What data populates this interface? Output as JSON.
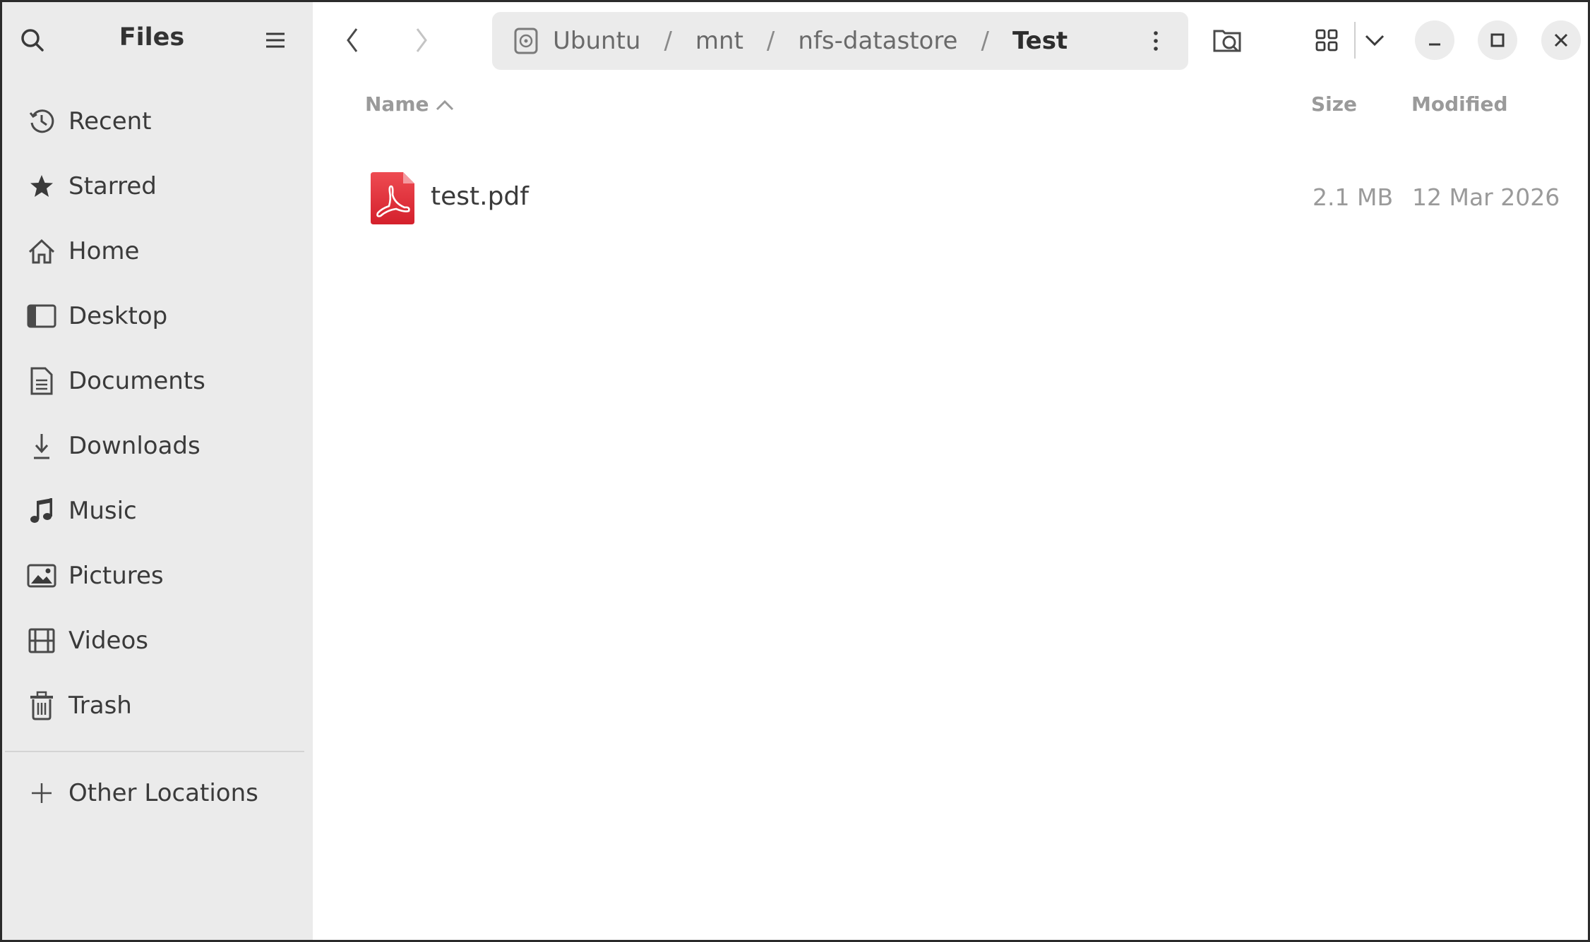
{
  "sidebar": {
    "title": "Files",
    "items": [
      {
        "label": "Recent",
        "icon": "clock-icon"
      },
      {
        "label": "Starred",
        "icon": "star-icon"
      },
      {
        "label": "Home",
        "icon": "home-icon"
      },
      {
        "label": "Desktop",
        "icon": "desktop-icon"
      },
      {
        "label": "Documents",
        "icon": "document-icon"
      },
      {
        "label": "Downloads",
        "icon": "download-icon"
      },
      {
        "label": "Music",
        "icon": "music-note-icon"
      },
      {
        "label": "Pictures",
        "icon": "picture-icon"
      },
      {
        "label": "Videos",
        "icon": "film-icon"
      },
      {
        "label": "Trash",
        "icon": "trash-icon"
      }
    ],
    "other_locations": {
      "label": "Other Locations",
      "icon": "plus-icon"
    }
  },
  "pathbar": {
    "crumbs": [
      "Ubuntu",
      "mnt",
      "nfs-datastore",
      "Test"
    ],
    "separator": "/",
    "drive_icon": "drive-icon"
  },
  "columns": {
    "name": "Name",
    "size": "Size",
    "modified": "Modified",
    "sort": "ascending"
  },
  "files": [
    {
      "name": "test.pdf",
      "size": "2.1 MB",
      "modified": "12 Mar 2026",
      "icon": "pdf-file-icon"
    }
  ],
  "colors": {
    "sidebar_bg": "#ebebeb",
    "pdf_red": "#e0323c",
    "window_border": "#2b2b2b"
  }
}
